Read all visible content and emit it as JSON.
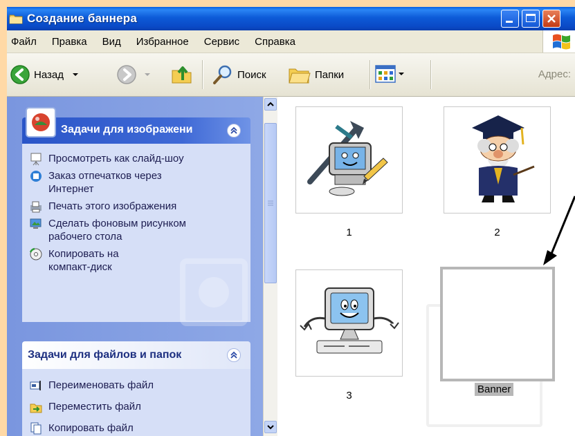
{
  "window": {
    "title": "Создание баннера"
  },
  "menu": [
    "Файл",
    "Правка",
    "Вид",
    "Избранное",
    "Сервис",
    "Справка"
  ],
  "toolbar": {
    "back": "Назад",
    "search": "Поиск",
    "folders": "Папки",
    "address": "Адрес:"
  },
  "image_tasks": {
    "title": "Задачи для изображени",
    "items": [
      {
        "label": "Просмотреть как слайд-шоу",
        "icon": "slideshow-icon"
      },
      {
        "label": "Заказ отпечатков через\nИнтернет",
        "icon": "order-prints-icon"
      },
      {
        "label": "Печать этого изображения",
        "icon": "print-icon"
      },
      {
        "label": "Сделать фоновым рисунком\nрабочего стола",
        "icon": "wallpaper-icon"
      },
      {
        "label": "Копировать на\nкомпакт-диск",
        "icon": "cd-icon"
      }
    ]
  },
  "file_tasks": {
    "title": "Задачи для файлов и папок",
    "items": [
      {
        "label": "Переименовать файл",
        "icon": "rename-icon"
      },
      {
        "label": "Переместить файл",
        "icon": "move-icon"
      },
      {
        "label": "Копировать файл",
        "icon": "copy-icon"
      }
    ]
  },
  "files": [
    {
      "name": "1",
      "picture": "computer-with-tools"
    },
    {
      "name": "2",
      "picture": "professor"
    },
    {
      "name": "3",
      "picture": "smiling-computer"
    },
    {
      "name": "Banner",
      "picture": "empty",
      "selected": true
    }
  ]
}
